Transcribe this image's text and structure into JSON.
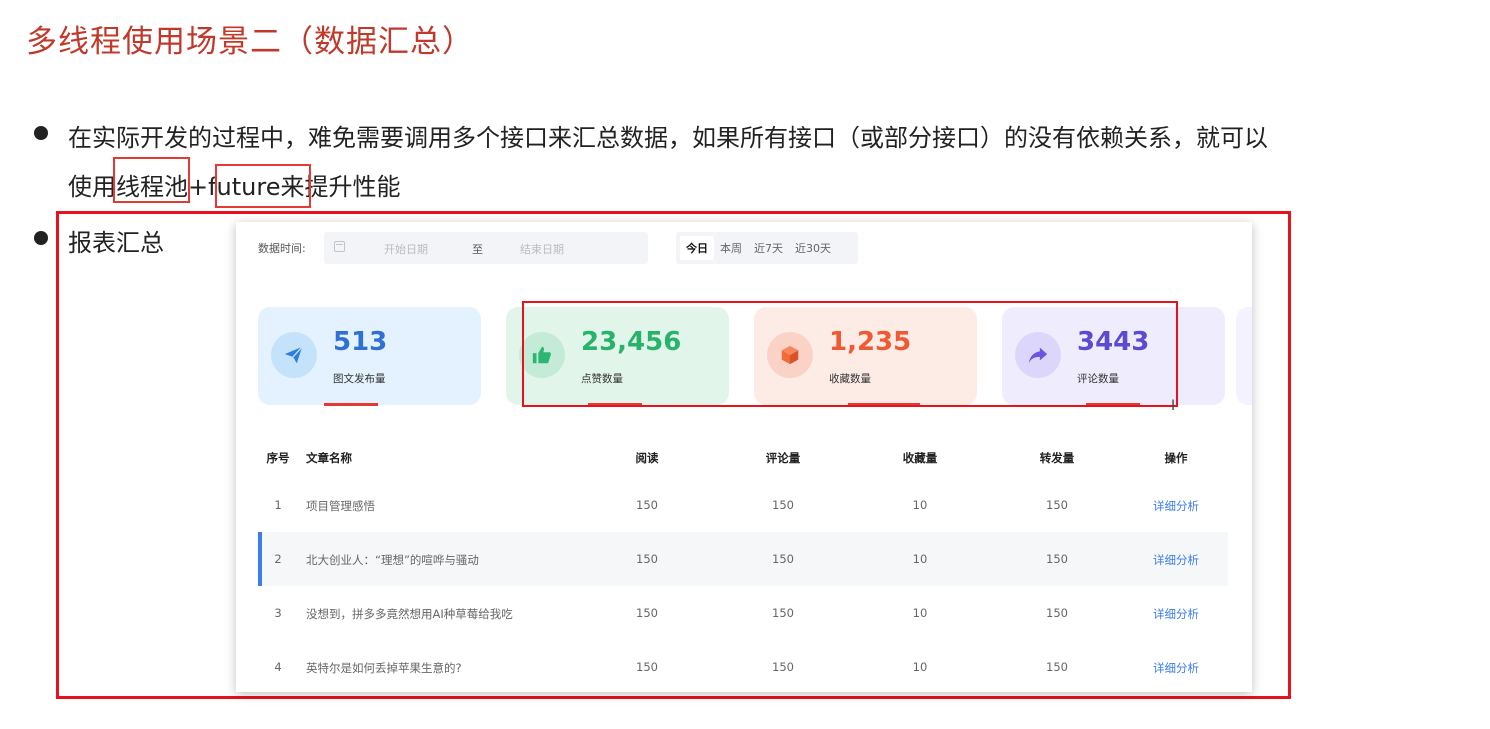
{
  "title": "多线程使用场景二（数据汇总）",
  "bullets": [
    {
      "line1": "在实际开发的过程中，难免需要调用多个接口来汇总数据，如果所有接口（或部分接口）的没有依赖关系，就可以",
      "line2": "使用线程池+future来提升性能"
    },
    {
      "line1": "报表汇总"
    }
  ],
  "filter": {
    "label": "数据时间:",
    "start_placeholder": "开始日期",
    "to": "至",
    "end_placeholder": "结束日期",
    "tabs": [
      "今日",
      "本周",
      "近7天",
      "近30天"
    ],
    "active_tab": "今日"
  },
  "cards": [
    {
      "value": "513",
      "label": "图文发布量",
      "icon": "paper-plane-icon",
      "bg": "#e3f2fe",
      "icon_bg": "#c5e2fb",
      "value_color": "#2f6fd6",
      "icon_color": "#2f7ddf"
    },
    {
      "value": "23,456",
      "label": "点赞数量",
      "icon": "thumbs-up-icon",
      "bg": "#e2f5eb",
      "icon_bg": "#c4ebd5",
      "value_color": "#27b36a",
      "icon_color": "#2bb673"
    },
    {
      "value": "1,235",
      "label": "收藏数量",
      "icon": "box-icon",
      "bg": "#fdebe6",
      "icon_bg": "#fbd2c6",
      "value_color": "#ef5a34",
      "icon_color": "#f06a3a"
    },
    {
      "value": "3443",
      "label": "评论数量",
      "icon": "share-arrow-icon",
      "bg": "#efedfd",
      "icon_bg": "#dcd6fb",
      "value_color": "#5b4bd1",
      "icon_color": "#6a55e0"
    }
  ],
  "table": {
    "headers": [
      "序号",
      "文章名称",
      "阅读",
      "评论量",
      "收藏量",
      "转发量",
      "操作"
    ],
    "rows": [
      {
        "no": "1",
        "name": "项目管理感悟",
        "read": "150",
        "comments": "150",
        "favorites": "10",
        "forwards": "150",
        "action": "详细分析"
      },
      {
        "no": "2",
        "name": "北大创业人：“理想”的喧哗与骚动",
        "read": "150",
        "comments": "150",
        "favorites": "10",
        "forwards": "150",
        "action": "详细分析"
      },
      {
        "no": "3",
        "name": "没想到，拼多多竟然想用AI种草莓给我吃",
        "read": "150",
        "comments": "150",
        "favorites": "10",
        "forwards": "150",
        "action": "详细分析"
      },
      {
        "no": "4",
        "name": "英特尔是如何丢掉苹果生意的?",
        "read": "150",
        "comments": "150",
        "favorites": "10",
        "forwards": "150",
        "action": "详细分析"
      }
    ]
  },
  "colors": {
    "title": "#c0392b",
    "annotation": "#e8121c",
    "link": "#3b7ded"
  }
}
